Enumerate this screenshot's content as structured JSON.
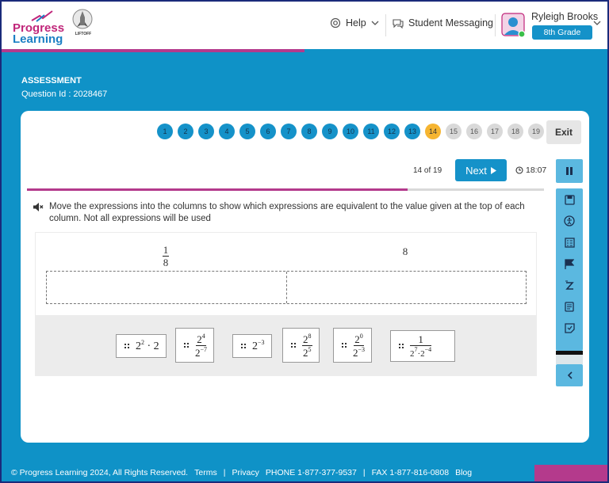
{
  "header": {
    "logo_line1": "Progress",
    "logo_line2": "Learning",
    "liftoff_label": "LIFTOFF",
    "help_label": "Help",
    "messaging_label": "Student Messaging",
    "user_name": "Ryleigh Brooks",
    "grade": "8th Grade"
  },
  "assessment": {
    "title": "ASSESSMENT",
    "question_id": "Question Id : 2028467"
  },
  "navigation": {
    "questions": [
      {
        "n": "1",
        "status": "done"
      },
      {
        "n": "2",
        "status": "done"
      },
      {
        "n": "3",
        "status": "done"
      },
      {
        "n": "4",
        "status": "done"
      },
      {
        "n": "5",
        "status": "done"
      },
      {
        "n": "6",
        "status": "done"
      },
      {
        "n": "7",
        "status": "done"
      },
      {
        "n": "8",
        "status": "done"
      },
      {
        "n": "9",
        "status": "done"
      },
      {
        "n": "10",
        "status": "done"
      },
      {
        "n": "11",
        "status": "done"
      },
      {
        "n": "12",
        "status": "done"
      },
      {
        "n": "13",
        "status": "done"
      },
      {
        "n": "14",
        "status": "current"
      },
      {
        "n": "15",
        "status": "todo"
      },
      {
        "n": "16",
        "status": "todo"
      },
      {
        "n": "17",
        "status": "todo"
      },
      {
        "n": "18",
        "status": "todo"
      },
      {
        "n": "19",
        "status": "todo"
      }
    ],
    "exit_label": "Exit",
    "count_text": "14 of 19",
    "next_label": "Next",
    "timer": "18:07",
    "progress_fraction": 0.736
  },
  "question": {
    "text": "Move the expressions into the columns to show which expressions are equivalent to the value given at the top of each column. Not all expressions will be used",
    "columns": [
      {
        "num": "1",
        "den": "8"
      },
      {
        "value": "8"
      }
    ],
    "tiles": [
      {
        "base": "2",
        "exp": "2",
        "rest": " · 2"
      },
      {
        "num_base": "2",
        "num_exp": "4",
        "den_base": "2",
        "den_exp": "−7"
      },
      {
        "base": "2",
        "exp": "−3"
      },
      {
        "num_base": "2",
        "num_exp": "8",
        "den_base": "2",
        "den_exp": "5"
      },
      {
        "num_base": "2",
        "num_exp": "0",
        "den_base": "2",
        "den_exp": "−3"
      },
      {
        "num": "1",
        "den_a": "2",
        "den_a_exp": "7",
        "den_mid": "·2",
        "den_b_exp": "−4"
      }
    ]
  },
  "tools": [
    "save-icon",
    "accessibility-icon",
    "answer-eliminator-icon",
    "flag-icon",
    "translate-icon",
    "notes-icon",
    "sticky-note-icon"
  ],
  "footer": {
    "copyright": "© Progress Learning 2024, All Rights Reserved.",
    "terms": "Terms",
    "sep1": "|",
    "privacy": "Privacy",
    "phone": "PHONE 1-877-377-9537",
    "sep2": "|",
    "fax": "FAX 1-877-816-0808",
    "blog": "Blog"
  },
  "colors": {
    "brand_blue": "#1592c9",
    "brand_magenta": "#b43a8c",
    "current_question": "#f6b531"
  }
}
